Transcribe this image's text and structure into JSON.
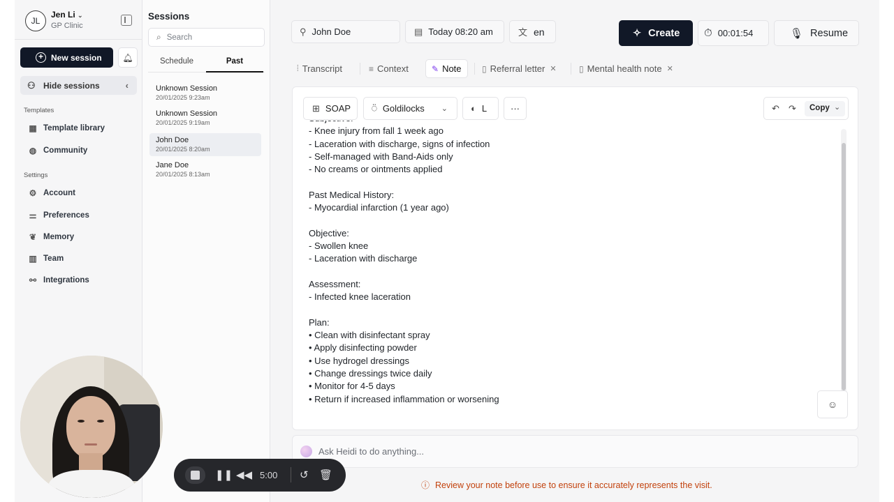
{
  "profile": {
    "initials": "JL",
    "name": "Jen Li",
    "clinic": "GP Clinic"
  },
  "sidebar": {
    "new_session": "New session",
    "hide_sessions": "Hide sessions",
    "templates_label": "Templates",
    "templates": [
      {
        "label": "Template library",
        "icon": "grid-icon"
      },
      {
        "label": "Community",
        "icon": "globe-icon"
      }
    ],
    "settings_label": "Settings",
    "settings": [
      {
        "label": "Account",
        "icon": "gear-icon"
      },
      {
        "label": "Preferences",
        "icon": "sliders-icon"
      },
      {
        "label": "Memory",
        "icon": "brain-icon"
      },
      {
        "label": "Team",
        "icon": "building-icon"
      },
      {
        "label": "Integrations",
        "icon": "plug-icon"
      }
    ]
  },
  "sessions": {
    "title": "Sessions",
    "search_placeholder": "Search",
    "tabs": [
      "Schedule",
      "Past"
    ],
    "active_tab": "Past",
    "items": [
      {
        "name": "Unknown Session",
        "date": "20/01/2025 9:23am"
      },
      {
        "name": "Unknown Session",
        "date": "20/01/2025 9:19am"
      },
      {
        "name": "John Doe",
        "date": "20/01/2025 8:20am"
      },
      {
        "name": "Jane Doe",
        "date": "20/01/2025 8:13am"
      }
    ]
  },
  "header": {
    "patient": "John Doe",
    "datetime": "Today 08:20 am",
    "language": "en",
    "create": "Create",
    "timer": "00:01:54",
    "resume": "Resume"
  },
  "doc_tabs": [
    {
      "label": "Transcript"
    },
    {
      "label": "Context"
    },
    {
      "label": "Note",
      "active": true
    },
    {
      "label": "Referral letter",
      "closable": true
    },
    {
      "label": "Mental health note",
      "closable": true
    }
  ],
  "toolbar": {
    "template": "SOAP",
    "style": "Goldilocks",
    "size": "L",
    "more": "···",
    "copy": "Copy"
  },
  "note_lines": [
    "Subjective:",
    "- Knee injury from fall 1 week ago",
    "- Laceration with discharge, signs of infection",
    "- Self-managed with Band-Aids only",
    "- No creams or ointments applied",
    "",
    "Past Medical History:",
    "- Myocardial infarction (1 year ago)",
    "",
    "Objective:",
    "- Swollen knee",
    "- Laceration with discharge",
    "",
    "Assessment:",
    "- Infected knee laceration",
    "",
    "Plan:",
    "• Clean with disinfectant spray",
    "• Apply disinfecting powder",
    "• Use hydrogel dressings",
    "• Change dressings twice daily",
    "• Monitor for 4-5 days",
    "• Return if increased inflammation or worsening"
  ],
  "ask": {
    "placeholder": "Ask Heidi to do anything..."
  },
  "disclaimer": "Review your note before use to ensure it accurately represents the visit.",
  "player": {
    "time": "5:00"
  },
  "colors": {
    "primary": "#111827",
    "warning": "#c2410c",
    "background": "#f5f5f6"
  }
}
